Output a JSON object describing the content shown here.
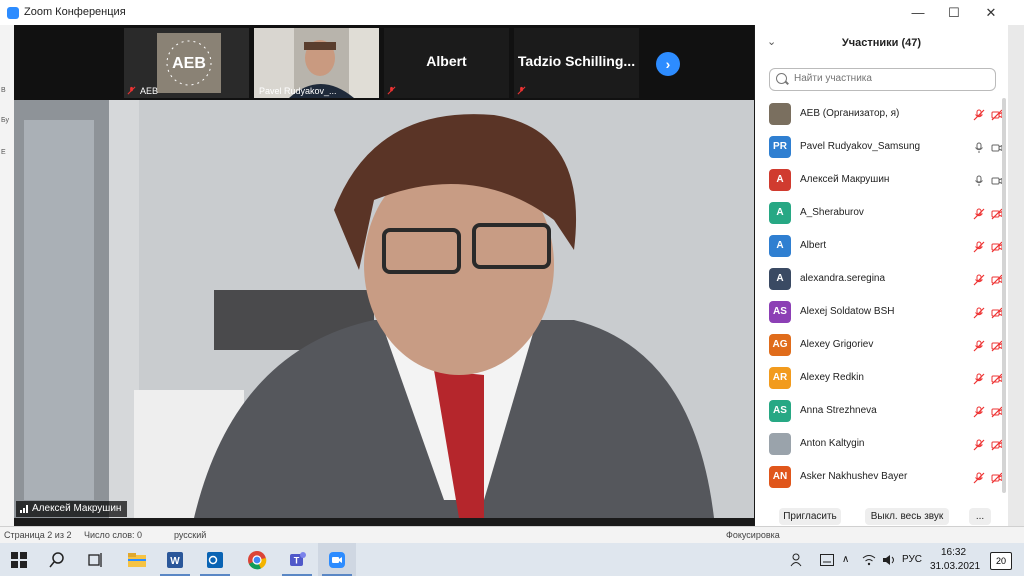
{
  "window": {
    "title": "Zoom Конференция",
    "minimize": "—",
    "maximize": "☐",
    "close": "✕"
  },
  "background": {
    "left_texts": [
      "В",
      "Бу",
      "Е"
    ],
    "status": {
      "page": "Страница 2 из 2",
      "words": "Число слов: 0",
      "lang": "русский",
      "focus": "Фокусировка"
    }
  },
  "video_strip": {
    "tiles": [
      {
        "name": "AEB",
        "kind": "logo",
        "logo_text": "AEB"
      },
      {
        "name": "Pavel Rudyakov_...",
        "kind": "video"
      },
      {
        "name": "Albert",
        "kind": "name"
      },
      {
        "name": "Tadzio Schilling...",
        "kind": "name"
      }
    ],
    "next_icon": "chevron-right-icon"
  },
  "main_video": {
    "speaker": "Алексей Макрушин"
  },
  "participants": {
    "header": "Участники (47)",
    "search_placeholder": "Найти участника",
    "list": [
      {
        "initials": "",
        "name": "AEB (Организатор, я)",
        "color": "#7a6f5f",
        "audio": "muted",
        "video": "off"
      },
      {
        "initials": "PR",
        "name": "Pavel Rudyakov_Samsung",
        "color": "#2f7fd1",
        "audio": "on",
        "video": "on"
      },
      {
        "initials": "A",
        "name": "Алексей Макрушин",
        "color": "#d03b2f",
        "audio": "on",
        "video": "on"
      },
      {
        "initials": "A",
        "name": "A_Sheraburov",
        "color": "#27a884",
        "audio": "muted",
        "video": "off"
      },
      {
        "initials": "A",
        "name": "Albert",
        "color": "#2f7fd1",
        "audio": "muted",
        "video": "off"
      },
      {
        "initials": "A",
        "name": "alexandra.seregina",
        "color": "#3a4a63",
        "audio": "muted",
        "video": "off"
      },
      {
        "initials": "AS",
        "name": "Alexej Soldatow BSH",
        "color": "#8c3fb5",
        "audio": "muted",
        "video": "off"
      },
      {
        "initials": "AG",
        "name": "Alexey Grigoriev",
        "color": "#e06c1b",
        "audio": "muted",
        "video": "off"
      },
      {
        "initials": "AR",
        "name": "Alexey Redkin",
        "color": "#f29b1d",
        "audio": "muted",
        "video": "off"
      },
      {
        "initials": "AS",
        "name": "Anna Strezhneva",
        "color": "#27a884",
        "audio": "muted",
        "video": "off"
      },
      {
        "initials": "",
        "name": "Anton Kaltygin",
        "color": "#9aa3ab",
        "audio": "muted",
        "video": "off"
      },
      {
        "initials": "AN",
        "name": "Asker Nakhushev Bayer",
        "color": "#e0561b",
        "audio": "muted",
        "video": "off"
      }
    ],
    "buttons": {
      "invite": "Пригласить",
      "mute_all": "Выкл. весь звук",
      "more": "..."
    }
  },
  "taskbar": {
    "apps": [
      "windows-start-icon",
      "search-icon",
      "task-view-icon",
      "file-explorer-icon",
      "word-icon",
      "outlook-icon",
      "chrome-icon",
      "teams-icon",
      "zoom-icon"
    ],
    "lang": "РУС",
    "time": "16:32",
    "date": "31.03.2021",
    "notifications": "20"
  }
}
